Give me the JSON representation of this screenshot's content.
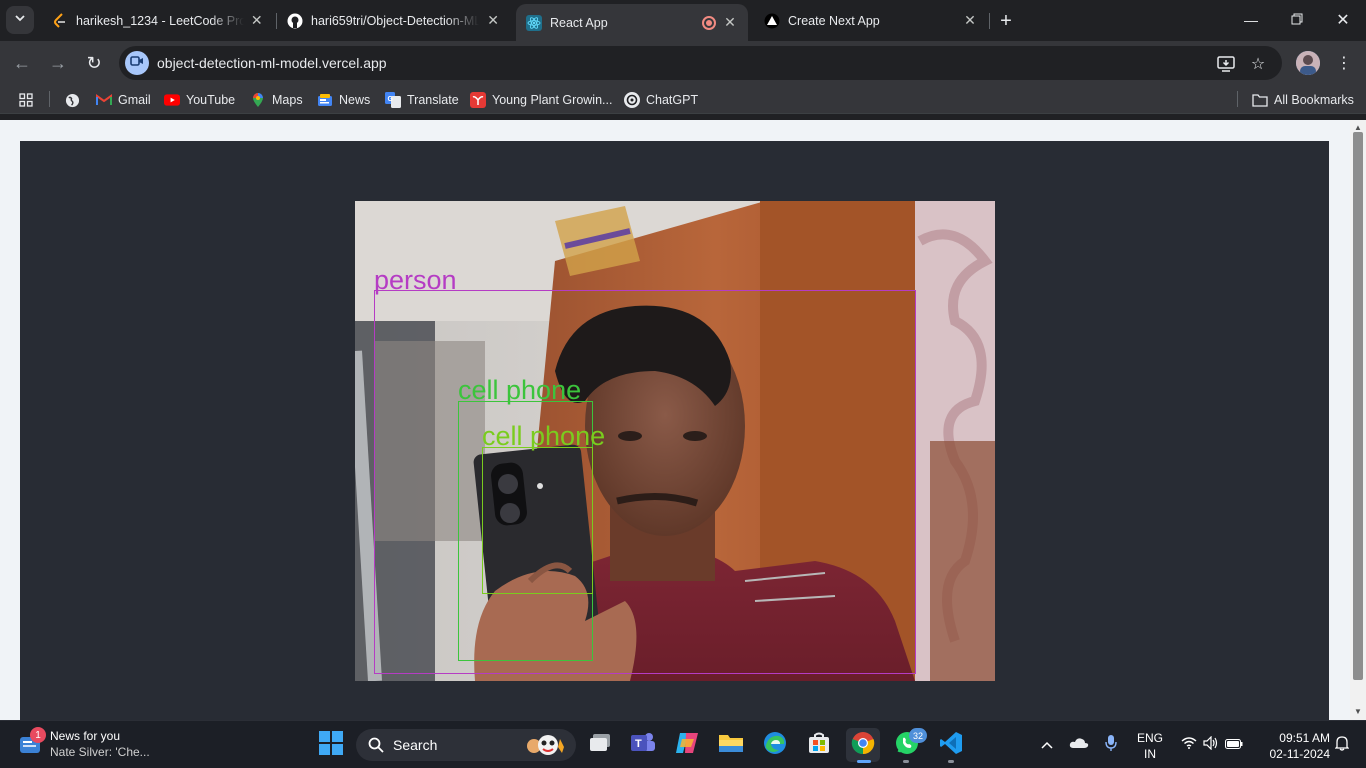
{
  "browser": {
    "tabs": [
      {
        "title": "harikesh_1234 - LeetCode Profile",
        "favicon": "leetcode-icon",
        "active": false
      },
      {
        "title": "hari659tri/Object-Detection-ML",
        "favicon": "github-icon",
        "active": false
      },
      {
        "title": "React App",
        "favicon": "react-icon",
        "active": true,
        "recording": true
      },
      {
        "title": "Create Next App",
        "favicon": "nextjs-icon",
        "active": false
      }
    ],
    "url": "object-detection-ml-model.vercel.app",
    "bookmarks": [
      {
        "label": "Gmail",
        "icon": "gmail-icon"
      },
      {
        "label": "YouTube",
        "icon": "youtube-icon"
      },
      {
        "label": "Maps",
        "icon": "maps-icon"
      },
      {
        "label": "News",
        "icon": "news-icon"
      },
      {
        "label": "Translate",
        "icon": "translate-icon"
      },
      {
        "label": "Young Plant Growin...",
        "icon": "plant-icon"
      },
      {
        "label": "ChatGPT",
        "icon": "chatgpt-icon"
      }
    ],
    "all_bookmarks": "All Bookmarks"
  },
  "page": {
    "detections": [
      {
        "label": "person",
        "color": "#b53cc4"
      },
      {
        "label": "cell phone",
        "color": "#3cc43c"
      },
      {
        "label": "cell phone",
        "color": "#7acc1e"
      }
    ]
  },
  "taskbar": {
    "news_badge": "1",
    "news_title": "News for you",
    "news_sub": "Nate Silver: 'Che...",
    "search_label": "Search",
    "whatsapp_badge": "32",
    "lang_top": "ENG",
    "lang_bottom": "IN",
    "time": "09:51 AM",
    "date": "02-11-2024"
  },
  "colors": {
    "page_bg": "#f0f3f7",
    "app_bg": "#282c34",
    "person_box": "#b53cc4",
    "phone_box_1": "#3cc43c",
    "phone_box_2": "#7acc1e"
  }
}
